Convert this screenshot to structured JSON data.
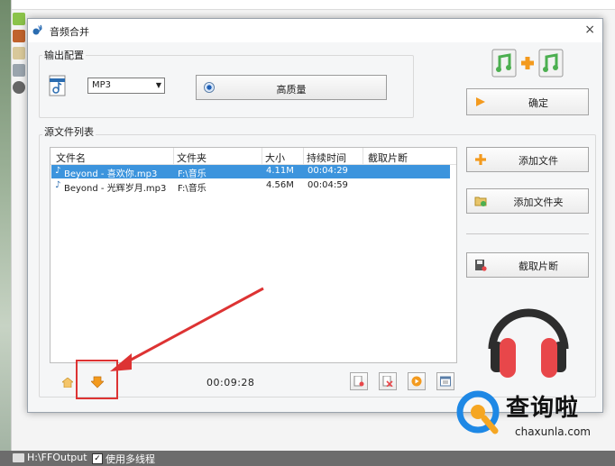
{
  "dialog": {
    "title": "音频合并",
    "close_icon": "×",
    "output_group_label": "输出配置",
    "format_value": "MP3",
    "quality_label": "高质量",
    "confirm_label": "确定",
    "source_group_label": "源文件列表",
    "columns": [
      "文件名",
      "文件夹",
      "大小",
      "持续时间",
      "截取片断"
    ],
    "files": [
      {
        "name": "Beyond - 喜欢你.mp3",
        "folder": "F:\\音乐",
        "size": "4.11M",
        "duration": "00:04:29",
        "clip": "",
        "selected": true
      },
      {
        "name": "Beyond - 光辉岁月.mp3",
        "folder": "F:\\音乐",
        "size": "4.56M",
        "duration": "00:04:59",
        "clip": "",
        "selected": false
      }
    ],
    "add_file_label": "添加文件",
    "add_folder_label": "添加文件夹",
    "clip_label": "截取片断",
    "total_time": "00:09:28"
  },
  "statusbar": {
    "output_path": "H:\\FFOutput",
    "multithread_checked": "✓",
    "multithread_label": "使用多线程"
  },
  "watermark": {
    "brand": "查询啦",
    "url": "chaxunla.com"
  },
  "colors": {
    "selection": "#3c94dd",
    "highlight": "#dd3333",
    "accent_orange": "#f39a1e",
    "headphone_red": "#e8474a"
  }
}
